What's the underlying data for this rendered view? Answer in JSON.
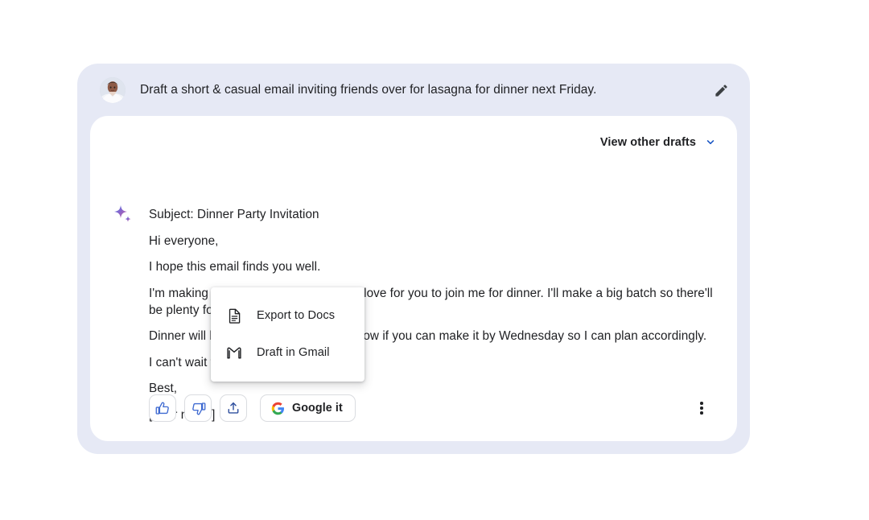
{
  "prompt": {
    "text": "Draft a short & casual email inviting friends over for lasagna for dinner next Friday.",
    "avatar_name": "user-avatar",
    "edit_icon": "pencil-icon"
  },
  "answer": {
    "drafts_toggle_label": "View other drafts",
    "drafts_chevron_icon": "chevron-down-icon",
    "sparkle_icon": "sparkle-icon",
    "lines": [
      "Subject: Dinner Party Invitation",
      "Hi everyone,",
      "I hope this email finds you well.",
      "I'm making lasagna next Friday and I'd love for you to join me for dinner. I'll make a big batch so there'll be plenty for everyone.",
      "Dinner will be at 7pm. Please let me know if you can make it by Wednesday so I can plan accordingly.",
      "I can't wait to see you all!",
      "Best,",
      "[Your name]"
    ]
  },
  "actions": {
    "thumbs_up_icon": "thumb-up-icon",
    "thumbs_down_icon": "thumb-down-icon",
    "share_icon": "share-icon",
    "google_it_label": "Google it",
    "google_logo_icon": "google-g-icon",
    "overflow_icon": "more-vertical-icon"
  },
  "export_menu": {
    "items": [
      {
        "label": "Export to Docs",
        "icon": "document-icon"
      },
      {
        "label": "Draft in Gmail",
        "icon": "gmail-icon"
      }
    ]
  },
  "colors": {
    "shell_background": "#e6e9f5",
    "card_background": "#ffffff",
    "text_primary": "#202124",
    "accent_blue": "#3f6ad1",
    "chevron_blue": "#1a56c4",
    "border_grey": "#dadce0",
    "google_blue": "#4285f4",
    "google_red": "#ea4335",
    "google_yellow": "#fbbc05",
    "google_green": "#34a853"
  }
}
